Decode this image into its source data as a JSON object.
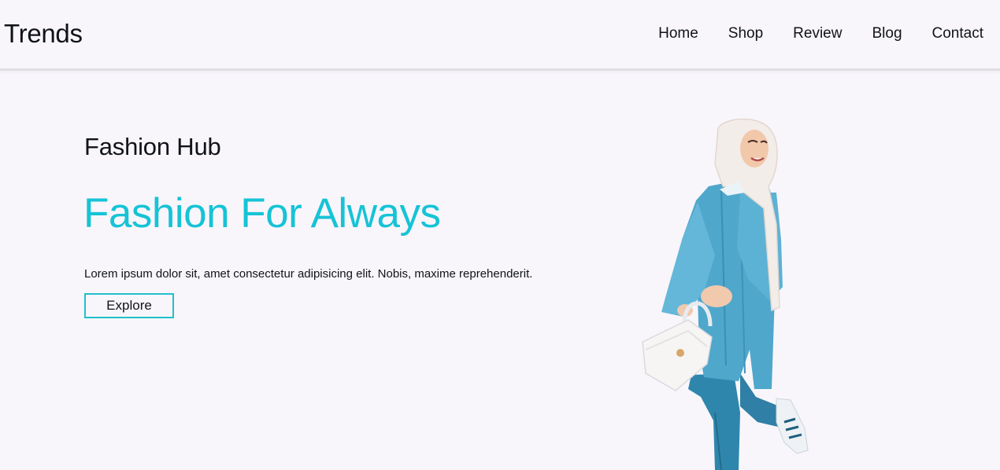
{
  "header": {
    "logo": "Trends",
    "nav": [
      "Home",
      "Shop",
      "Review",
      "Blog",
      "Contact"
    ]
  },
  "hero": {
    "subtitle": "Fashion Hub",
    "headline": "Fashion For Always",
    "lead": "Lorem ipsum dolor sit, amet consectetur adipisicing elit. Nobis, maxime reprehenderit.",
    "button": "Explore"
  },
  "colors": {
    "background": "#f8f6fb",
    "accent": "#16c3d6",
    "text": "#111318"
  },
  "image": {
    "name": "woman-in-blue-outfit-with-handbag"
  }
}
